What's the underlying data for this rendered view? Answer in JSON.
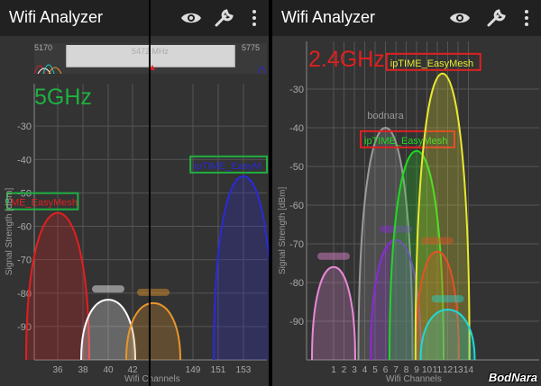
{
  "left": {
    "app_title": "Wifi Analyzer",
    "band_label": "5GHz",
    "overview": {
      "start": "5170",
      "mid": "5472 MHz",
      "end": "5775"
    },
    "y_axis_label": "Signal Strength [dBm]",
    "x_axis_label": "Wifi Channels",
    "chart_data": {
      "type": "area",
      "ylim": [
        -100,
        -20
      ],
      "yticks": [
        -30,
        -40,
        -50,
        -60,
        -70,
        -80,
        -90
      ],
      "xticks": [
        "36",
        "38",
        "40",
        "42",
        "149",
        "151",
        "153"
      ],
      "series": [
        {
          "name": "ME_EasyMesh",
          "color": "#e02020",
          "peak": -56,
          "boxed": true
        },
        {
          "name": "",
          "color": "#ffffff",
          "peak": -82,
          "boxed": false
        },
        {
          "name": "",
          "color": "#e8962a",
          "peak": -83,
          "boxed": false
        },
        {
          "name": "ipTIME_EasyM",
          "color": "#2a2ad8",
          "peak": -45,
          "boxed": true
        }
      ]
    }
  },
  "right": {
    "app_title": "Wifi Analyzer",
    "band_label": "2.4GHz",
    "y_axis_label": "Signal Strength [dBm]",
    "x_axis_label": "Wifi Channels",
    "chart_data": {
      "type": "area",
      "ylim": [
        -100,
        -20
      ],
      "yticks": [
        -30,
        -40,
        -50,
        -60,
        -70,
        -80,
        -90
      ],
      "xticks": [
        "1",
        "2",
        "3",
        "4",
        "5",
        "6",
        "7",
        "8",
        "9",
        "10",
        "11",
        "12",
        "13",
        "14"
      ],
      "series": [
        {
          "name": "",
          "color": "#e88ad8",
          "peak": -76,
          "center": 1,
          "boxed": false
        },
        {
          "name": "bodnara",
          "color": "#9a9a9a",
          "peak": -40,
          "center": 6,
          "boxed": false
        },
        {
          "name": "",
          "color": "#8a2ad8",
          "peak": -69,
          "center": 7,
          "boxed": false
        },
        {
          "name": "ipTIME_EasyMesh",
          "color": "#20d820",
          "peak": -46,
          "center": 9,
          "boxed": true
        },
        {
          "name": "",
          "color": "#e02020",
          "peak": -72,
          "center": 11,
          "boxed": false
        },
        {
          "name": "ipTIME_EasyMesh",
          "color": "#e8e830",
          "peak": -26,
          "center": 11.5,
          "boxed": true
        },
        {
          "name": "",
          "color": "#20d8d8",
          "peak": -87,
          "center": 12,
          "boxed": false
        }
      ]
    }
  },
  "watermark": "BodNara",
  "colors": {
    "appbar": "#212121",
    "panel_bg": "#333333",
    "grid": "#555555"
  }
}
